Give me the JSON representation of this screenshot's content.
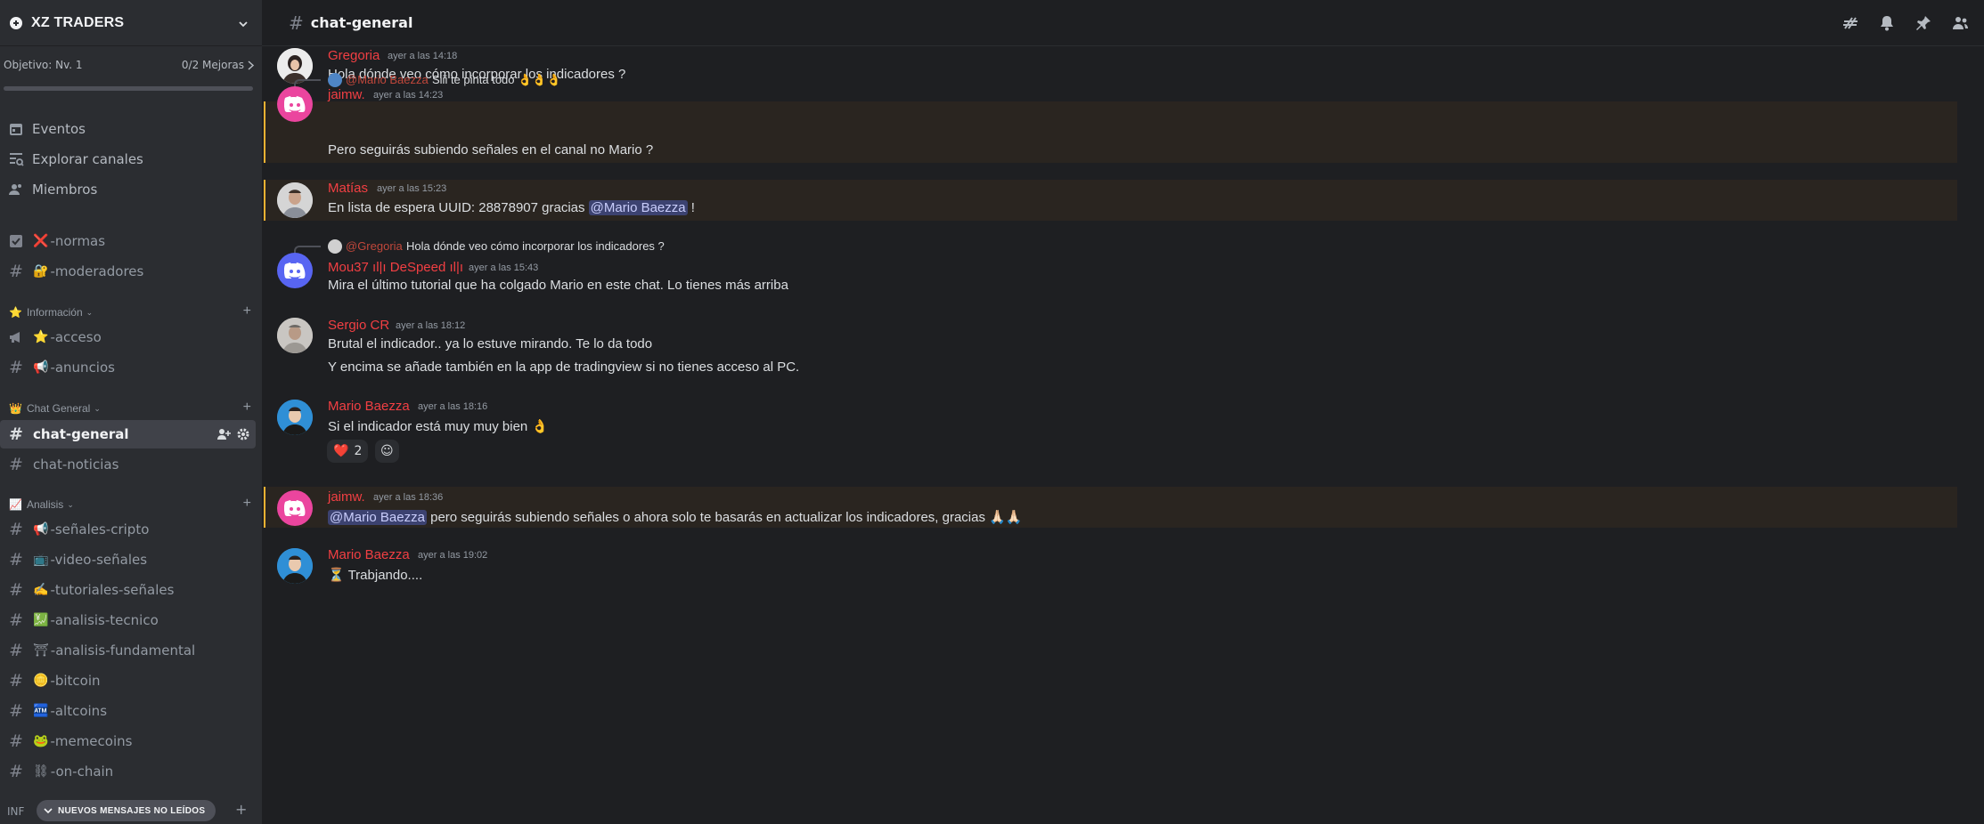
{
  "server": {
    "name": "XZ TRADERS",
    "goal_left": "Objetivo: Nv. 1",
    "goal_right": "0/2 Mejoras",
    "goal_progress": 0
  },
  "sidebar": {
    "nav": [
      {
        "label": "Eventos",
        "icon": "calendar-icon"
      },
      {
        "label": "Explorar canales",
        "icon": "browse-channels-icon"
      },
      {
        "label": "Miembros",
        "icon": "members-icon"
      }
    ],
    "top_channels": [
      {
        "emoji": "❌",
        "label": "-normas",
        "icon": "rules-icon"
      },
      {
        "emoji": "🔐",
        "label": "-moderadores",
        "icon": "hash-icon"
      }
    ],
    "categories": [
      {
        "name": "Información",
        "emoji": "⭐",
        "channels": [
          {
            "emoji": "⭐",
            "label": "-acceso",
            "icon": "announcement-icon"
          },
          {
            "emoji": "📢",
            "label": "-anuncios",
            "icon": "hash-icon"
          }
        ]
      },
      {
        "name": "Chat General",
        "emoji": "👑",
        "channels": [
          {
            "emoji": "",
            "label": "chat-general",
            "icon": "hash-icon",
            "active": true
          },
          {
            "emoji": "",
            "label": "chat-noticias",
            "icon": "hash-icon"
          }
        ]
      },
      {
        "name": "Analisis",
        "emoji": "📈",
        "channels": [
          {
            "emoji": "📢",
            "label": "-señales-cripto"
          },
          {
            "emoji": "📺",
            "label": "-video-señales"
          },
          {
            "emoji": "✍️",
            "label": "-tutoriales-señales"
          },
          {
            "emoji": "💹",
            "label": "-analisis-tecnico"
          },
          {
            "emoji": "⛩",
            "label": "-analisis-fundamental"
          },
          {
            "emoji": "🪙",
            "label": "-bitcoin"
          },
          {
            "emoji": "🏧",
            "label": "-altcoins"
          },
          {
            "emoji": "🐸",
            "label": "-memecoins"
          },
          {
            "emoji": "⛓",
            "label": "-on-chain"
          }
        ]
      }
    ],
    "bottom_category": "INF",
    "new_messages_pill": "NUEVOS MENSAJES NO LEÍDOS"
  },
  "header": {
    "channel": "chat-general",
    "icons": [
      "threads-icon",
      "bell-icon",
      "pin-icon",
      "member-list-icon"
    ]
  },
  "messages": [
    {
      "author": "Gregoria",
      "time": "ayer a las 14:18",
      "text": "Hola dónde veo cómo incorporar los indicadores ?",
      "avatar": "photo-woman"
    },
    {
      "author": "jaimw.",
      "time": "ayer a las 14:23",
      "text": "Pero seguirás subiendo señales en el canal no  Mario ?",
      "avatar": "discord-pink",
      "highlight": true,
      "reply": {
        "name": "@Mario Baezza",
        "text": "Siii te pinta todo 👌👌👌"
      }
    },
    {
      "author": "Matías",
      "time": "ayer a las 15:23",
      "text_before": "En lista de espera UUID: 28878907 gracias ",
      "mention": "@Mario Baezza",
      "text_after": " !",
      "avatar": "photo-man",
      "highlight": true
    },
    {
      "author": "Mou37 ıl|ı DeSpeed ıl|ı",
      "time": "ayer a las 15:43",
      "text": "Mira el último tutorial que ha colgado Mario en este chat. Lo tienes más arriba",
      "avatar": "discord-blurple",
      "reply": {
        "name": "@Gregoria",
        "text": "Hola dónde veo cómo incorporar los indicadores ?"
      }
    },
    {
      "author": "Sergio CR",
      "time": "ayer a las 18:12",
      "text": "Brutal el indicador.. ya lo estuve mirando. Te lo da todo",
      "text2": "Y encima se añade también en la app de tradingview si no tienes acceso al PC.",
      "avatar": "photo-sergio"
    },
    {
      "author": "Mario Baezza",
      "time": "ayer a las 18:16",
      "text": "Si el indicador está muy muy bien 👌",
      "avatar": "photo-mario",
      "reactions": [
        {
          "emoji": "❤️",
          "count": "2"
        },
        {
          "emoji": "☺",
          "count": ""
        }
      ]
    },
    {
      "author": "jaimw.",
      "time": "ayer a las 18:36",
      "mention": "@Mario Baezza",
      "text_after": "  pero seguirás subiendo señales o ahora solo te basarás en actualizar los indicadores, gracias 🙏🏻🙏🏻",
      "avatar": "discord-pink",
      "highlight": true
    },
    {
      "author": "Mario Baezza",
      "time": "ayer a las 19:02",
      "text": "⏳ Trabjando....",
      "avatar": "photo-mario",
      "attachment": "video"
    }
  ],
  "colors": {
    "sidebar_bg": "#2b2d31",
    "chat_bg": "#1e1f22",
    "username_red": "#f23f43",
    "mention_bg": "#3c4270",
    "highlight_border": "#f0b232",
    "discord_pink": "#eb459e",
    "discord_blurple": "#5865f2"
  }
}
